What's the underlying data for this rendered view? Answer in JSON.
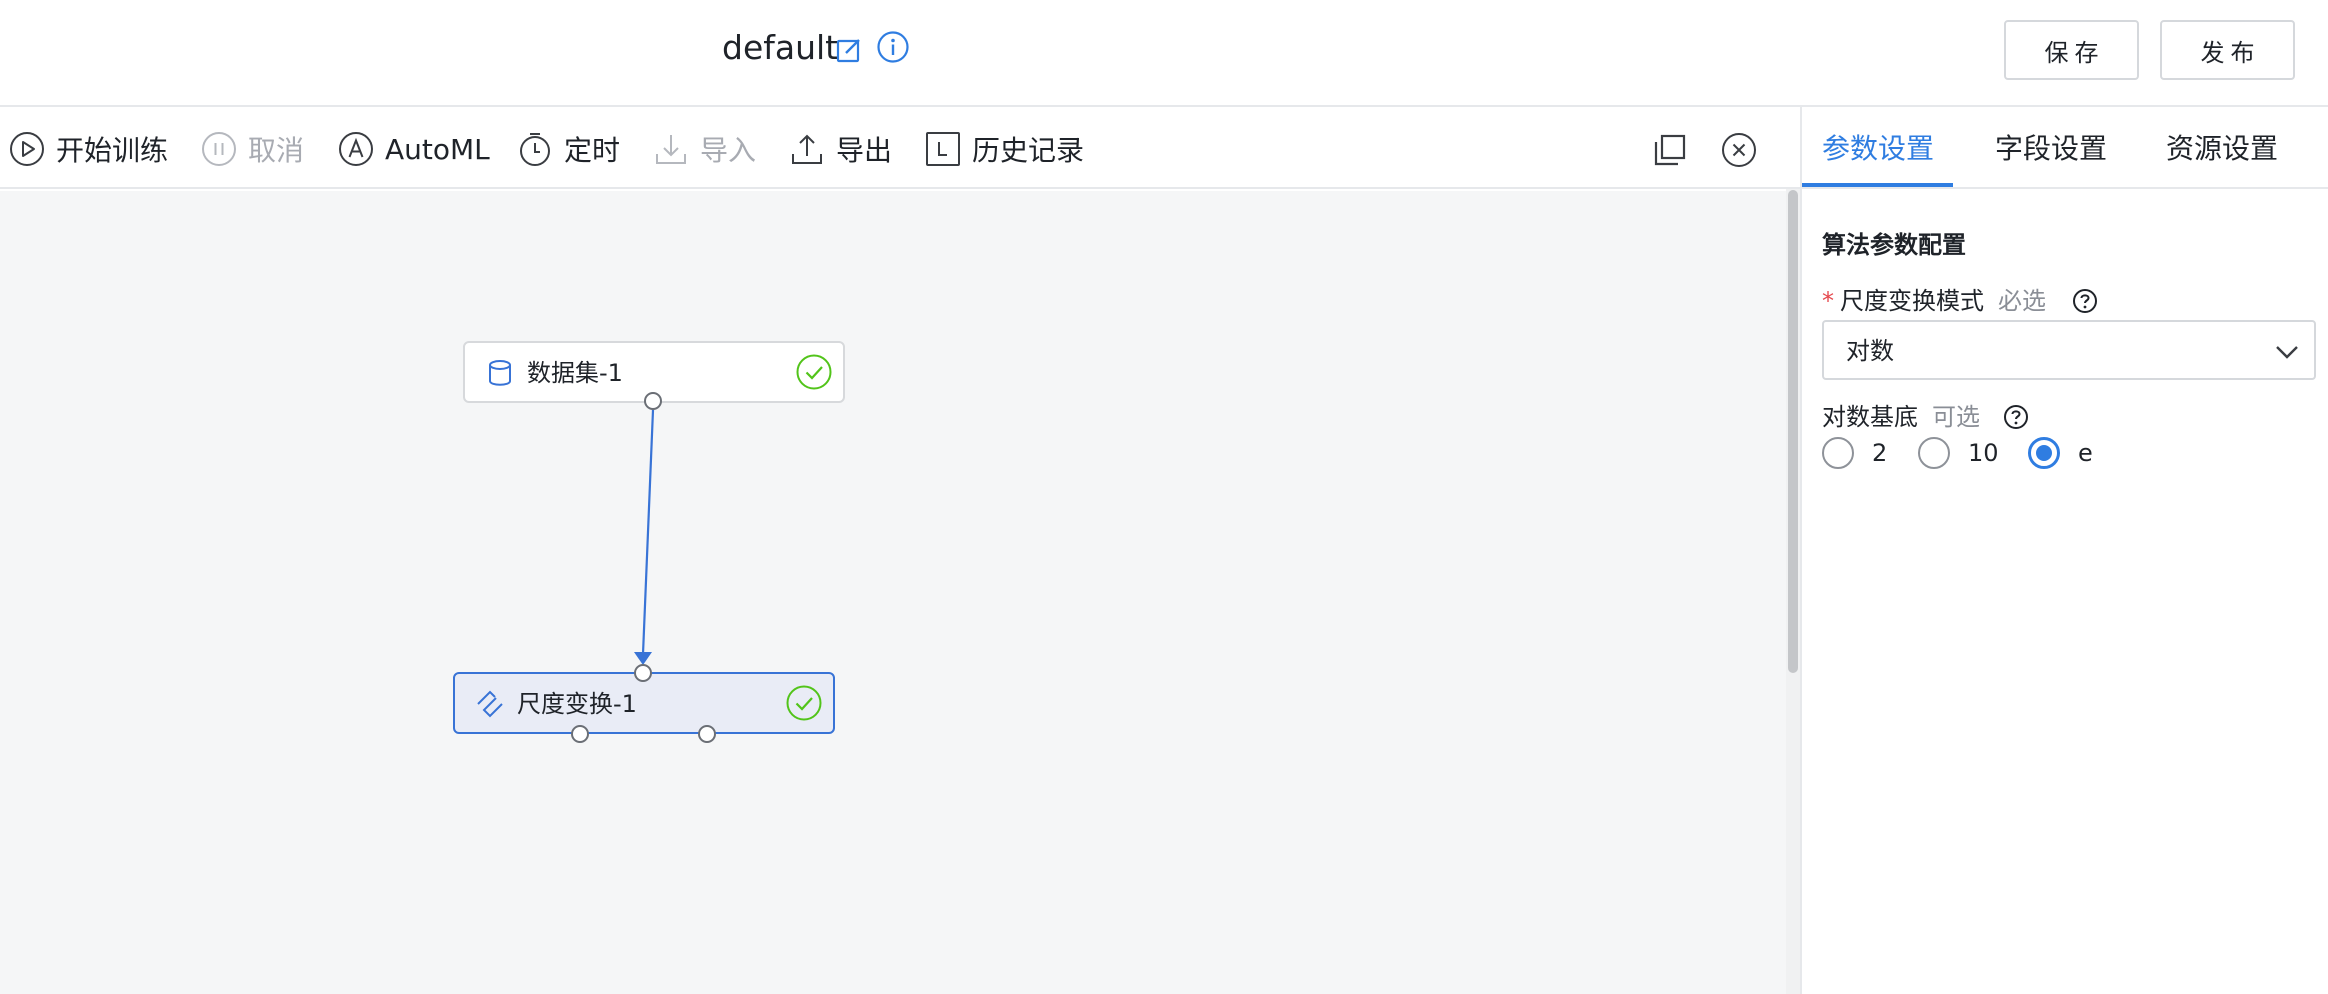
{
  "header": {
    "title": "default",
    "save_label": "保存",
    "publish_label": "发布"
  },
  "toolbar": {
    "start_training": "开始训练",
    "cancel": "取消",
    "automl": "AutoML",
    "schedule": "定时",
    "import": "导入",
    "export": "导出",
    "history": "历史记录"
  },
  "canvas": {
    "nodes": [
      {
        "label": "数据集-1",
        "status": "success"
      },
      {
        "label": "尺度变换-1",
        "status": "success",
        "selected": true
      }
    ]
  },
  "panel": {
    "tabs": [
      {
        "label": "参数设置",
        "active": true
      },
      {
        "label": "字段设置",
        "active": false
      },
      {
        "label": "资源设置",
        "active": false
      }
    ],
    "section_title": "算法参数配置",
    "scale_mode": {
      "label": "尺度变换模式",
      "tag": "必选",
      "value": "对数"
    },
    "log_base": {
      "label": "对数基底",
      "tag": "可选",
      "options": [
        "2",
        "10",
        "e"
      ],
      "selected": "e"
    }
  },
  "colors": {
    "accent": "#2f7de1",
    "success": "#52c41a",
    "required": "#e5484d"
  }
}
